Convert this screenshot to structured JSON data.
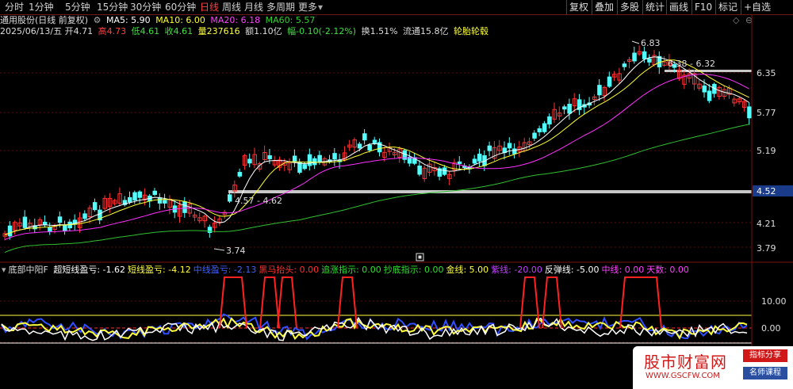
{
  "timeframes": [
    "分时",
    "1分钟",
    "5分钟",
    "15分钟",
    "30分钟",
    "60分钟",
    "日线",
    "周线",
    "月线",
    "多周期",
    "更多"
  ],
  "active_timeframe": "日线",
  "buttons": [
    "复权",
    "叠加",
    "多股",
    "统计",
    "画线",
    "F10",
    "标记",
    "+自选"
  ],
  "header": {
    "stock_name": "通用股份(日线 前复权)",
    "ma5": "MA5: 5.90",
    "ma10": "MA10: 6.00",
    "ma20": "MA20: 6.18",
    "ma60": "MA60: 5.57"
  },
  "info": {
    "date": "2025/06/13/五",
    "open": "开4.71",
    "high": "高4.73",
    "low": "低4.61",
    "close": "收4.61",
    "volume": "量237616",
    "amount": "额1.10亿",
    "change": "幅-0.10(-2.12%)",
    "turnover": "换1.51%",
    "float_cap": "流通15.8亿",
    "concept": "轮胎轮毂"
  },
  "indicator": {
    "name": "底部中阳F",
    "items": [
      {
        "label": "超短线盈亏: -1.62",
        "color": "#ffffff"
      },
      {
        "label": "短线盈亏: -4.12",
        "color": "#ffff40"
      },
      {
        "label": "中线盈亏: -2.13",
        "color": "#4060ff"
      },
      {
        "label": "黑马抬头: 0.00",
        "color": "#ff3030"
      },
      {
        "label": "追涨指示: 0.00",
        "color": "#30e030"
      },
      {
        "label": "抄底指示: 0.00",
        "color": "#30e030"
      },
      {
        "label": "金线: 5.00",
        "color": "#ffff40"
      },
      {
        "label": "紫线: -20.00",
        "color": "#c040ff"
      },
      {
        "label": "反弹线: -5.00",
        "color": "#ffffff"
      },
      {
        "label": "中线: 0.00",
        "color": "#ff40ff"
      },
      {
        "label": "天数: 0.00",
        "color": "#ff40ff"
      }
    ]
  },
  "price_axis": [
    "6.35",
    "5.77",
    "5.19",
    "4.52",
    "4.21",
    "3.79"
  ],
  "price_tag": "4.52",
  "ind_axis": [
    "10.00",
    "0.00"
  ],
  "annotations": {
    "high": "6.83",
    "low": "3.74",
    "box1": "4.57 - 4.62",
    "box2": "6.38 - 6.32"
  },
  "watermark": {
    "main": "股市财富网",
    "url": "WWW.GSCFW.COM",
    "badge1": "指标分享",
    "badge2": "名师课程"
  },
  "colors": {
    "up": "#ff3232",
    "down": "#54ffff",
    "ma5": "#ffffff",
    "ma10": "#ffff30",
    "ma20": "#ff30ff",
    "ma60": "#30c030"
  }
}
